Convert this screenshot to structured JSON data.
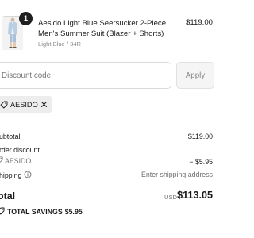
{
  "product": {
    "image": "seersucker-suit-thumbnail",
    "quantity": "1",
    "title": "Aesido Light Blue Seersucker 2-Piece Men's Summer Suit (Blazer + Shorts)",
    "variant": "Light Blue / 34R",
    "price": "$119.00"
  },
  "discount": {
    "placeholder": "Discount code",
    "value": "",
    "apply_label": "Apply",
    "applied_code": "AESIDO",
    "tag_icon": "tag-icon",
    "remove_icon": "close-icon"
  },
  "summary": {
    "subtotal_label": "ubtotal",
    "subtotal_value": "$119.00",
    "order_discount_label": "rder discount",
    "order_discount_code": "AESIDO",
    "order_discount_value": "− $5.95",
    "shipping_label": "hipping",
    "shipping_info_icon": "info-icon",
    "shipping_value": "Enter shipping address",
    "total_label": "otal",
    "total_currency": "USD",
    "total_value": "$113.05",
    "savings_icon": "tag-icon",
    "savings_label": "TOTAL SAVINGS",
    "savings_value": "$5.95"
  },
  "colors": {
    "text": "#1a1a1a",
    "muted": "#707070",
    "border": "#d9d9d9",
    "chip_bg": "#ededed",
    "badge_bg": "#1f1f1f"
  }
}
